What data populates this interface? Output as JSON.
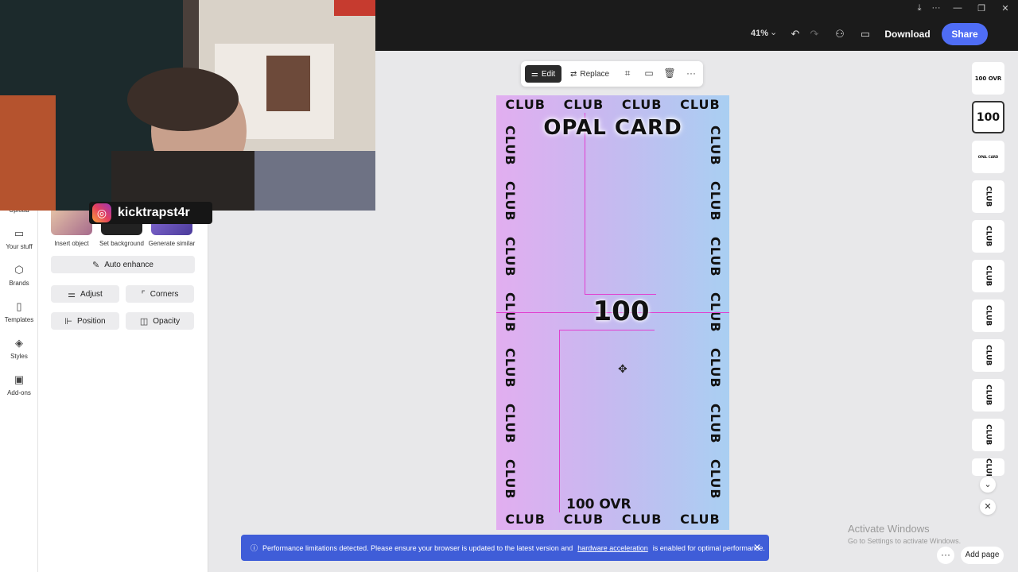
{
  "toolbar": {
    "zoom": "41%",
    "download_label": "Download",
    "share_label": "Share",
    "icons": [
      "undo-icon",
      "redo-icon",
      "invite-icon",
      "comment-icon",
      "download-arrow-icon",
      "more-icon"
    ]
  },
  "webcam": {
    "instagram_handle": "kicktrapst4r"
  },
  "rail": {
    "items": [
      {
        "label": "Upload",
        "icon": "upload-icon"
      },
      {
        "label": "Your stuff",
        "icon": "folder-icon"
      },
      {
        "label": "Brands",
        "icon": "brand-icon"
      },
      {
        "label": "Templates",
        "icon": "templates-icon"
      },
      {
        "label": "Styles",
        "icon": "styles-icon"
      },
      {
        "label": "Add-ons",
        "icon": "addons-icon"
      }
    ]
  },
  "panel": {
    "quick_actions": [
      "Insert object",
      "Set background",
      "Generate similar"
    ],
    "auto_enhance": "Auto enhance",
    "adjust": "Adjust",
    "corners": "Corners",
    "position": "Position",
    "opacity": "Opacity"
  },
  "canvas_toolbar": {
    "edit": "Edit",
    "replace": "Replace"
  },
  "card": {
    "title": "OPAL CARD",
    "rating": "100",
    "ovr": "100 OVR",
    "border_word": "CLUB",
    "colors": {
      "left": "#e2aef0",
      "right": "#a9cff2",
      "guide": "#e13fcf"
    }
  },
  "pages": {
    "thumbs": [
      "100 OVR",
      "100",
      "OPAL CARD",
      "CLUB",
      "CLUB",
      "CLUB",
      "CLUB",
      "CLUB",
      "CLUB",
      "CLUB",
      "CLUB"
    ],
    "add_page": "Add page"
  },
  "notice": {
    "text_before": "Performance limitations detected. Please ensure your browser is updated to the latest version and",
    "link": "hardware acceleration",
    "text_after": "is enabled for optimal performance."
  },
  "watermark": {
    "title": "Activate Windows",
    "subtitle": "Go to Settings to activate Windows."
  }
}
